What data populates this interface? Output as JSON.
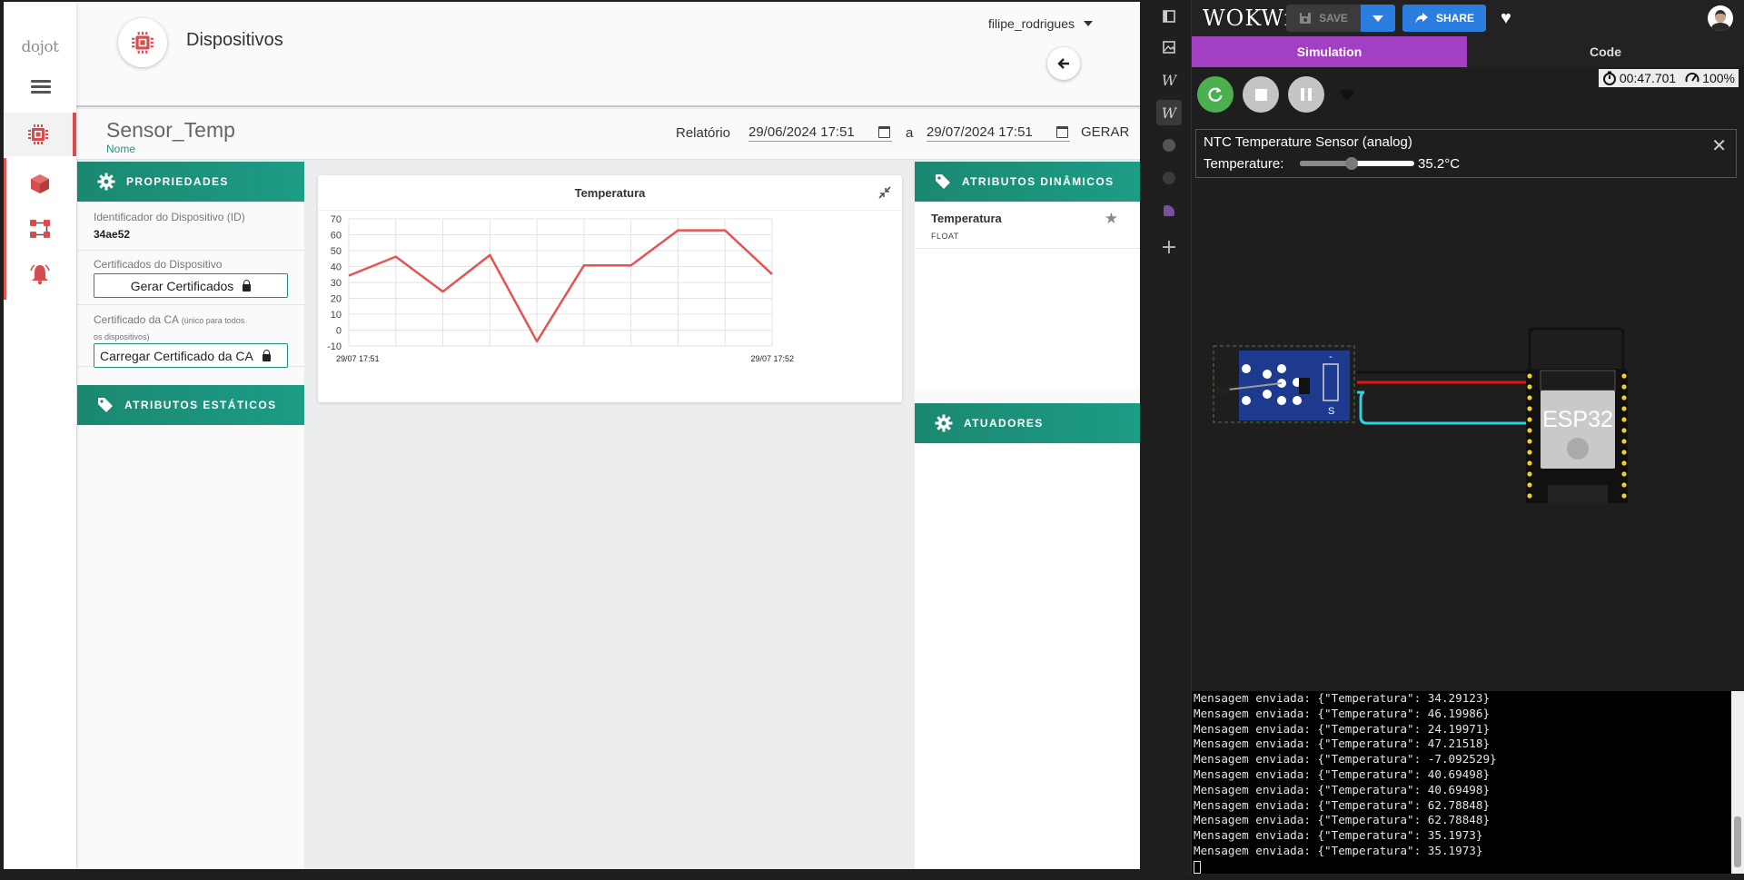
{
  "dojot": {
    "logo": "dojot",
    "page_title": "Dispositivos",
    "user": "filipe_rodrigues",
    "device_name": "Sensor_Temp",
    "device_name_label": "Nome",
    "report_label": "Relatório",
    "date_from": "29/06/2024 17:51",
    "date_sep": "a",
    "date_to": "29/07/2024 17:51",
    "generate_label": "GERAR",
    "properties": {
      "title": "PROPRIEDADES",
      "id_label": "Identificador do Dispositivo (ID)",
      "id_value": "34ae52",
      "certs_label": "Certificados do Dispositivo",
      "certs_button": "Gerar Certificados",
      "ca_label": "Certificado da CA",
      "ca_note": "(único para todos os dispositivos)",
      "ca_button": "Carregar Certificado da CA"
    },
    "static_attrs_title": "ATRIBUTOS ESTÁTICOS",
    "dynamic_attrs_title": "ATRIBUTOS DINÂMICOS",
    "dynamic_attr": {
      "name": "Temperatura",
      "type": "FLOAT"
    },
    "actuators_title": "ATUADORES",
    "accent": "#1b8870",
    "alert": "#d74c4c"
  },
  "chart_data": {
    "type": "line",
    "title": "Temperatura",
    "x": [
      "29/07 17:51",
      "",
      "",
      "",
      "",
      "",
      "",
      "",
      "",
      "29/07 17:52"
    ],
    "x_tick_labels": [
      "29/07 17:51",
      "29/07 17:52"
    ],
    "series": [
      {
        "values": [
          34.29123,
          46.19986,
          24.19971,
          47.21518,
          -7.092529,
          40.69498,
          40.69498,
          62.78848,
          62.78848,
          35.1973
        ],
        "color": "#e55353"
      }
    ],
    "ylim": [
      -10,
      70
    ],
    "yticks": [
      70,
      60,
      50,
      40,
      30,
      20,
      10,
      0,
      -10
    ],
    "grid": true
  },
  "wokwi": {
    "logo": "WOKWi",
    "save_label": "SAVE",
    "share_label": "SHARE",
    "tab_simulation": "Simulation",
    "tab_code": "Code",
    "timer": "00:47.701",
    "speed": "100%",
    "popup_title": "NTC Temperature Sensor (analog)",
    "popup_label": "Temperature:",
    "popup_value": "35.2°C",
    "slider_fraction": 0.45,
    "board_label": "ESP32",
    "sensor_pin_label": "S",
    "sensor_minus_label": "-",
    "serial_lines": [
      "Mensagem enviada: {\"Temperatura\": 34.29123}",
      "Mensagem enviada: {\"Temperatura\": 46.19986}",
      "Mensagem enviada: {\"Temperatura\": 24.19971}",
      "Mensagem enviada: {\"Temperatura\": 47.21518}",
      "Mensagem enviada: {\"Temperatura\": -7.092529}",
      "Mensagem enviada: {\"Temperatura\": 40.69498}",
      "Mensagem enviada: {\"Temperatura\": 40.69498}",
      "Mensagem enviada: {\"Temperatura\": 62.78848}",
      "Mensagem enviada: {\"Temperatura\": 62.78848}",
      "Mensagem enviada: {\"Temperatura\": 35.1973}",
      "Mensagem enviada: {\"Temperatura\": 35.1973}"
    ]
  }
}
